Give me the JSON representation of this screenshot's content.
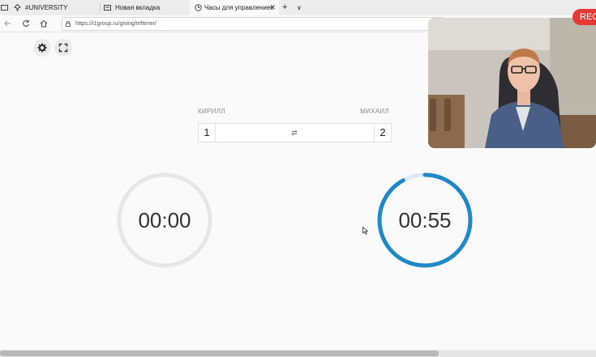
{
  "browser": {
    "tabs": [
      {
        "label": "#UNIVERSITY",
        "icon": "pin-icon"
      },
      {
        "label": "Новая вкладка",
        "icon": "newtab-icon"
      },
      {
        "label": "Часы для управлениес",
        "icon": "clock-icon",
        "active": true
      }
    ],
    "new_tab_symbol": "+",
    "tab_list_symbol": "∨",
    "close_symbol": "✕",
    "url": "https://i1group.ru/giving/mftimer/"
  },
  "controls": {
    "settings_icon": "gear-icon",
    "fullscreen_icon": "fullscreen-icon"
  },
  "players": {
    "left": {
      "name": "КИРИЛЛ",
      "score": "1",
      "time": "00:00",
      "progress": 0
    },
    "right": {
      "name": "МИХАИЛ",
      "score": "2",
      "time": "00:55",
      "progress": 0.92
    },
    "swap_symbol": "⇄"
  },
  "overlay": {
    "rec_label": "REC"
  },
  "colors": {
    "timer_active": "#1e88c8",
    "timer_track": "#e6e6e6",
    "rec": "#e53935"
  }
}
